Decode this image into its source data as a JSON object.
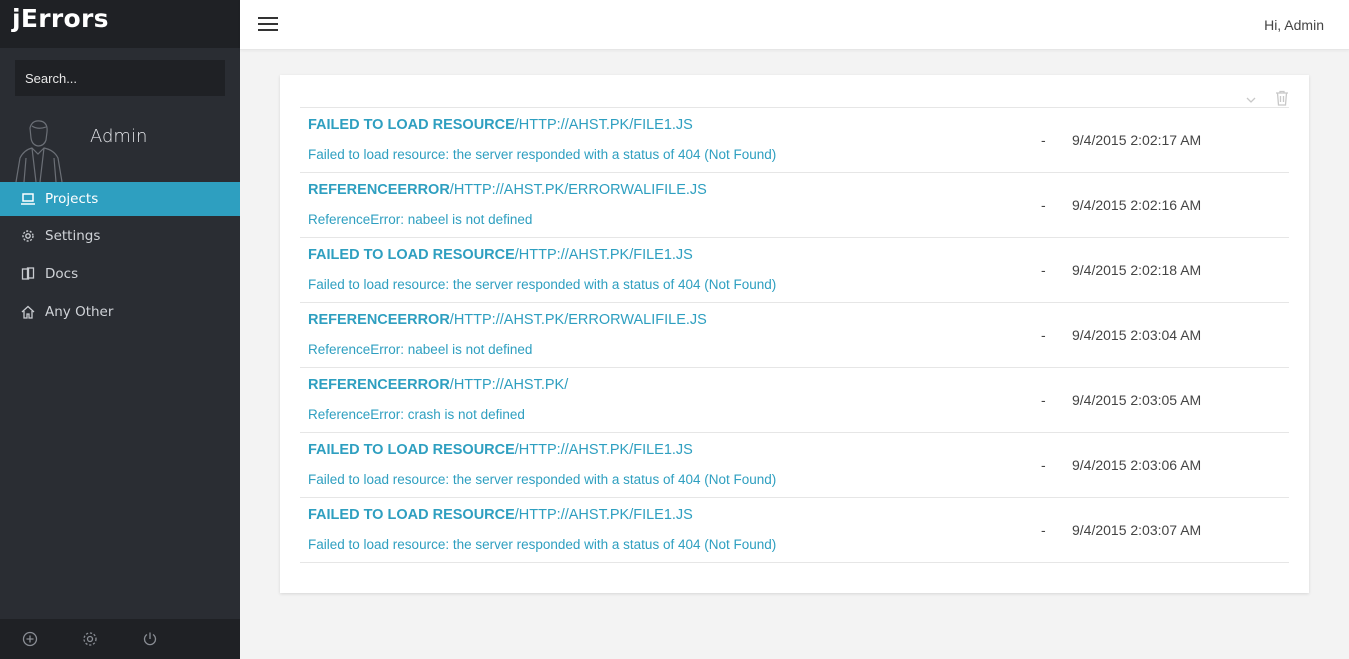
{
  "app": {
    "brand": "jErrors",
    "search_placeholder": "Search...",
    "profile_name": "Admin"
  },
  "sidebar": {
    "items": [
      {
        "label": "Projects",
        "icon": "laptop-icon",
        "active": true
      },
      {
        "label": "Settings",
        "icon": "gear-icon",
        "active": false
      },
      {
        "label": "Docs",
        "icon": "docs-icon",
        "active": false
      },
      {
        "label": "Any Other",
        "icon": "home-icon",
        "active": false
      }
    ],
    "footer_icons": [
      "add-icon",
      "settings-icon",
      "power-icon"
    ]
  },
  "header": {
    "greeting": "Hi, Admin"
  },
  "errors": [
    {
      "name": "FAILED TO LOAD RESOURCE",
      "url": "/HTTP://AHST.PK/FILE1.JS",
      "message": "Failed to load resource: the server responded with a status of 404 (Not Found)",
      "dash": "-",
      "time": "9/4/2015 2:02:17 AM"
    },
    {
      "name": "REFERENCEERROR",
      "url": "/HTTP://AHST.PK/ERRORWALIFILE.JS",
      "message": "ReferenceError: nabeel is not defined",
      "dash": "-",
      "time": "9/4/2015 2:02:16 AM"
    },
    {
      "name": "FAILED TO LOAD RESOURCE",
      "url": "/HTTP://AHST.PK/FILE1.JS",
      "message": "Failed to load resource: the server responded with a status of 404 (Not Found)",
      "dash": "-",
      "time": "9/4/2015 2:02:18 AM"
    },
    {
      "name": "REFERENCEERROR",
      "url": "/HTTP://AHST.PK/ERRORWALIFILE.JS",
      "message": "ReferenceError: nabeel is not defined",
      "dash": "-",
      "time": "9/4/2015 2:03:04 AM"
    },
    {
      "name": "REFERENCEERROR",
      "url": "/HTTP://AHST.PK/",
      "message": "ReferenceError: crash is not defined",
      "dash": "-",
      "time": "9/4/2015 2:03:05 AM"
    },
    {
      "name": "FAILED TO LOAD RESOURCE",
      "url": "/HTTP://AHST.PK/FILE1.JS",
      "message": "Failed to load resource: the server responded with a status of 404 (Not Found)",
      "dash": "-",
      "time": "9/4/2015 2:03:06 AM"
    },
    {
      "name": "FAILED TO LOAD RESOURCE",
      "url": "/HTTP://AHST.PK/FILE1.JS",
      "message": "Failed to load resource: the server responded with a status of 404 (Not Found)",
      "dash": "-",
      "time": "9/4/2015 2:03:07 AM"
    }
  ],
  "colors": {
    "accent": "#2e9fc0",
    "sidebar_bg": "#2a2d33",
    "sidebar_dark": "#1f2125"
  }
}
